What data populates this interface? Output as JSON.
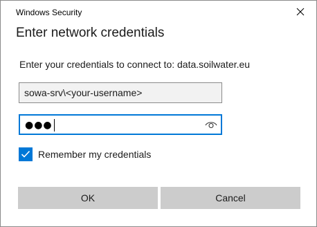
{
  "window": {
    "title": "Windows Security",
    "close_icon": "close-icon"
  },
  "dialog": {
    "heading": "Enter network credentials",
    "description": "Enter your credentials to connect to: data.soilwater.eu"
  },
  "username": {
    "value": "sowa-srv\\<your-username>",
    "placeholder": ""
  },
  "password": {
    "masked_value": "●●●",
    "reveal_icon": "eye-icon"
  },
  "remember": {
    "label": "Remember my credentials",
    "checked": true
  },
  "buttons": {
    "ok_label": "OK",
    "cancel_label": "Cancel"
  },
  "colors": {
    "accent": "#0078d7",
    "button_bg": "#cccccc",
    "field_bg": "#f2f2f2"
  }
}
